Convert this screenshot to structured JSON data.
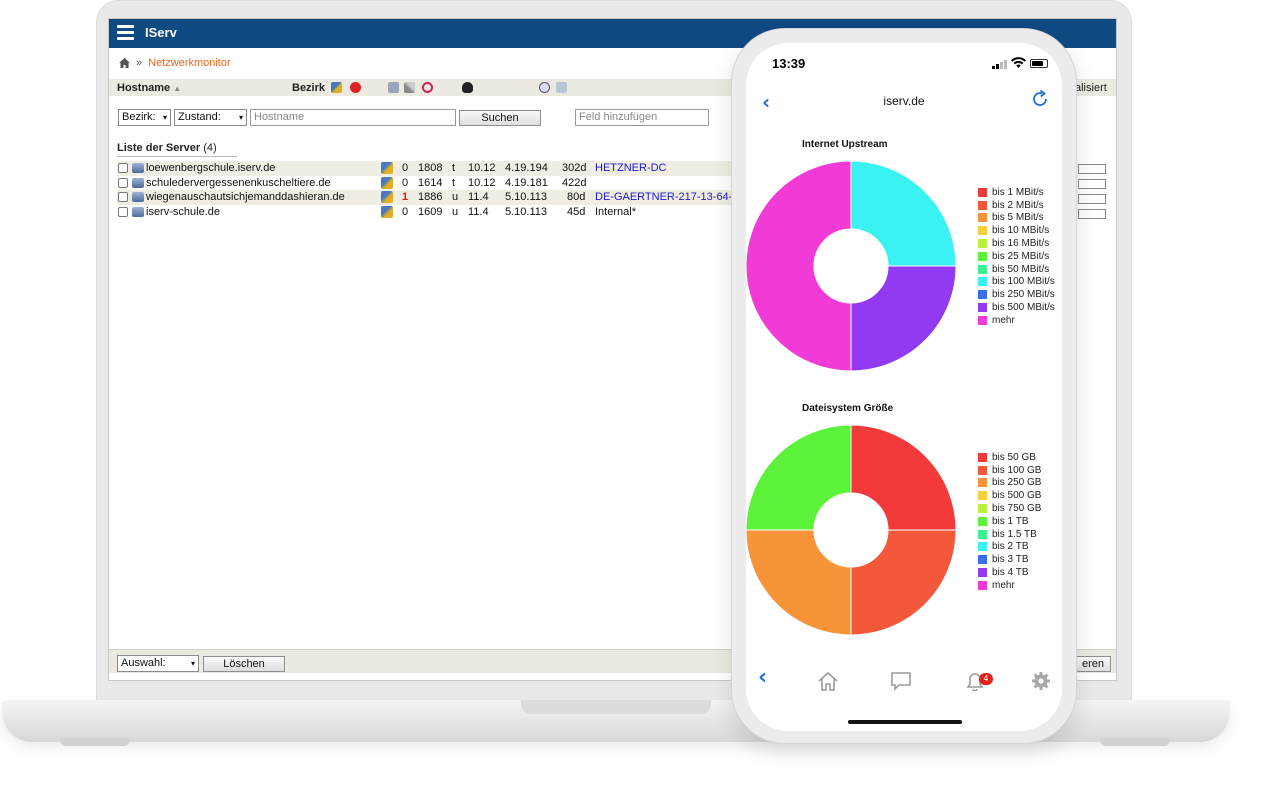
{
  "laptop": {
    "app_title": "IServ",
    "breadcrumb_current": "Netzwerkmonitor",
    "table_header": {
      "hostname": "Hostname",
      "bezirk": "Bezirk",
      "right_cut": "alisiert"
    },
    "filters": {
      "bezirk_label": "Bezirk:",
      "zustand_label": "Zustand:",
      "hostname_placeholder": "Hostname",
      "search_button": "Suchen",
      "add_field_placeholder": "Feld hinzufügen"
    },
    "list_title": "Liste der Server",
    "list_count": "(4)",
    "servers": [
      {
        "hostname": "loewenbergschule.iserv.de",
        "status": "0",
        "value": "1808",
        "code": "t",
        "version": "10.12",
        "kernel": "4.19.194",
        "uptime": "302d",
        "location": "HETZNER-DC"
      },
      {
        "hostname": "schuledervergessenenkuscheltiere.de",
        "status": "0",
        "value": "1614",
        "code": "t",
        "version": "10.12",
        "kernel": "4.19.181",
        "uptime": "422d",
        "location": ""
      },
      {
        "hostname": "wiegenauschautsichjemanddashieran.de",
        "status": "1",
        "value": "1886",
        "code": "u",
        "version": "11.4",
        "kernel": "5.10.113",
        "uptime": "80d",
        "location": "DE-GAERTNER-217-13-64-"
      },
      {
        "hostname": "iserv-schule.de",
        "status": "0",
        "value": "1609",
        "code": "u",
        "version": "11.4",
        "kernel": "5.10.113",
        "uptime": "45d",
        "location": "Internal*"
      }
    ],
    "footer": {
      "selection_label": "Auswahl:",
      "delete_button": "Löschen",
      "right_cut": "eren"
    }
  },
  "phone": {
    "time": "13:39",
    "nav_title": "iserv.de",
    "notification_count": "4",
    "colors": {
      "accent": "#1d6fd8",
      "laptop_header": "#104a83",
      "breadcrumb_link": "#e8661e"
    }
  },
  "chart_data": [
    {
      "type": "pie",
      "title": "Internet Upstream",
      "legend_placement": "right",
      "legend": [
        {
          "label": "bis 1 MBit/s",
          "color": "#f23a3a"
        },
        {
          "label": "bis 2 MBit/s",
          "color": "#f4583a"
        },
        {
          "label": "bis 5 MBit/s",
          "color": "#f7943a"
        },
        {
          "label": "bis 10 MBit/s",
          "color": "#f4d03a"
        },
        {
          "label": "bis 16 MBit/s",
          "color": "#b8f23a"
        },
        {
          "label": "bis 25 MBit/s",
          "color": "#5cf23a"
        },
        {
          "label": "bis 50 MBit/s",
          "color": "#3af290"
        },
        {
          "label": "bis 100 MBit/s",
          "color": "#3af2f2"
        },
        {
          "label": "bis 250 MBit/s",
          "color": "#3a6ef2"
        },
        {
          "label": "bis 500 MBit/s",
          "color": "#913af2"
        },
        {
          "label": "mehr",
          "color": "#f23ad6"
        }
      ],
      "slices": [
        {
          "label": "bis 100 MBit/s",
          "value": 1,
          "color": "#3af2f2"
        },
        {
          "label": "bis 500 MBit/s",
          "value": 1,
          "color": "#913af2"
        },
        {
          "label": "mehr",
          "value": 2,
          "color": "#f23ad6"
        }
      ]
    },
    {
      "type": "pie",
      "title": "Dateisystem Größe",
      "legend_placement": "right",
      "legend": [
        {
          "label": "bis 50 GB",
          "color": "#f23a3a"
        },
        {
          "label": "bis 100 GB",
          "color": "#f4583a"
        },
        {
          "label": "bis 250 GB",
          "color": "#f7943a"
        },
        {
          "label": "bis 500 GB",
          "color": "#f4d03a"
        },
        {
          "label": "bis 750 GB",
          "color": "#b8f23a"
        },
        {
          "label": "bis 1 TB",
          "color": "#5cf23a"
        },
        {
          "label": "bis 1.5 TB",
          "color": "#3af290"
        },
        {
          "label": "bis 2 TB",
          "color": "#3af2f2"
        },
        {
          "label": "bis 3 TB",
          "color": "#3a6ef2"
        },
        {
          "label": "bis 4 TB",
          "color": "#913af2"
        },
        {
          "label": "mehr",
          "color": "#f23ad6"
        }
      ],
      "slices": [
        {
          "label": "bis 50 GB",
          "value": 1,
          "color": "#f23a3a"
        },
        {
          "label": "bis 100 GB",
          "value": 1,
          "color": "#f4583a"
        },
        {
          "label": "bis 250 GB",
          "value": 1,
          "color": "#f7943a"
        },
        {
          "label": "bis 1 TB",
          "value": 1,
          "color": "#5cf23a"
        }
      ]
    }
  ]
}
